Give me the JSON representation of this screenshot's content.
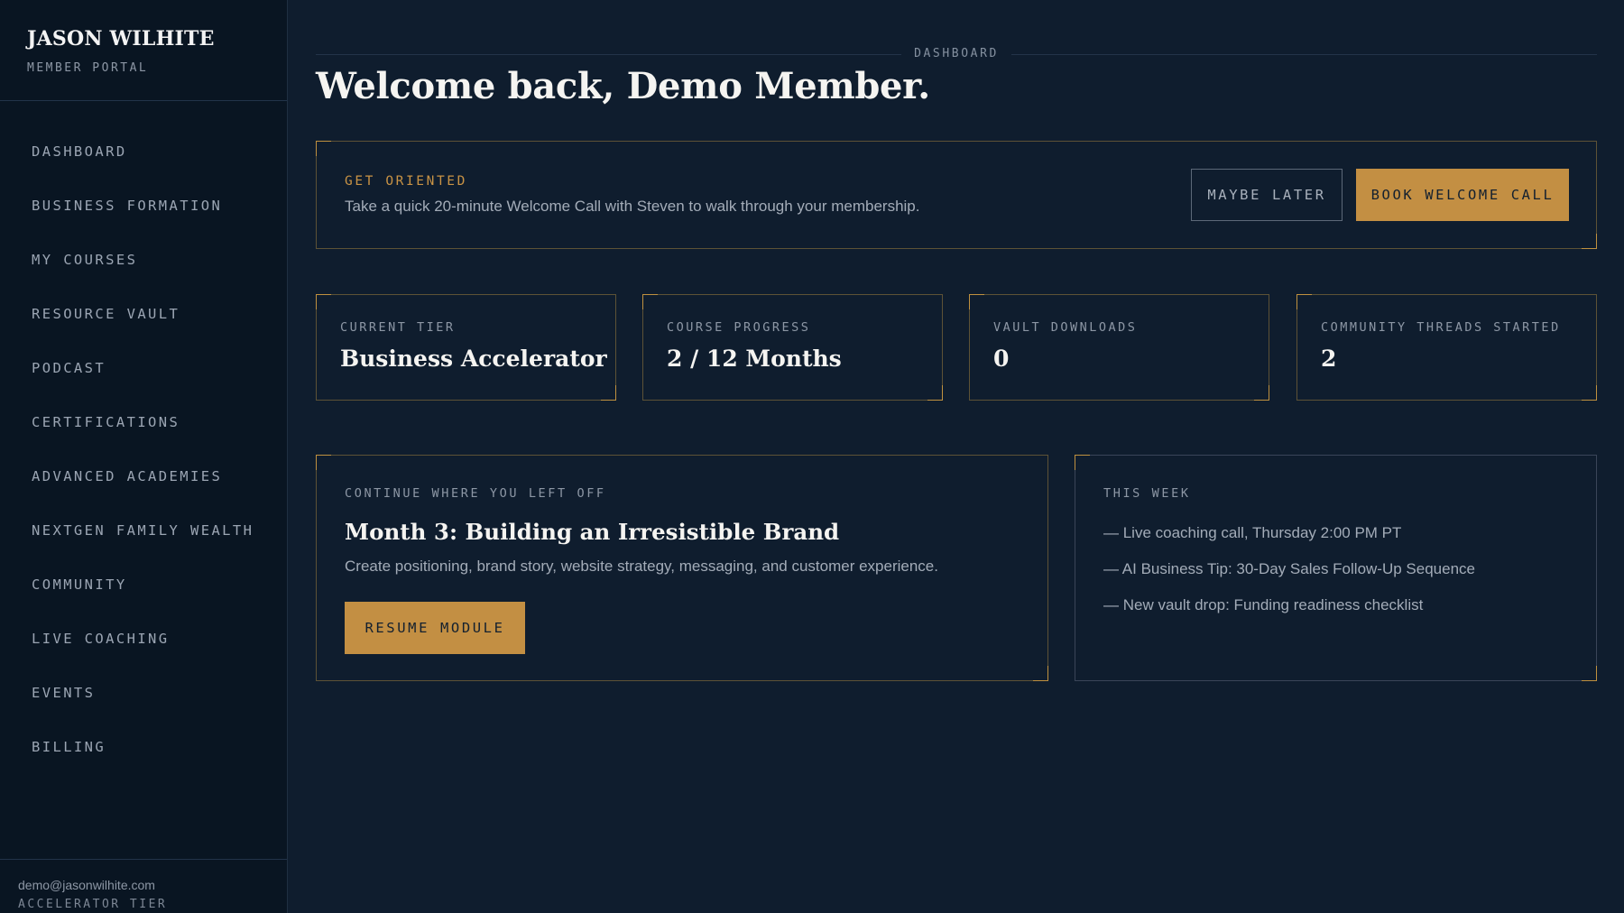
{
  "brand": {
    "name": "JASON WILHITE",
    "subtitle": "MEMBER PORTAL"
  },
  "nav": [
    "DASHBOARD",
    "BUSINESS FORMATION",
    "MY COURSES",
    "RESOURCE VAULT",
    "PODCAST",
    "CERTIFICATIONS",
    "ADVANCED ACADEMIES",
    "NEXTGEN FAMILY WEALTH",
    "COMMUNITY",
    "LIVE COACHING",
    "EVENTS",
    "BILLING"
  ],
  "account": {
    "email": "demo@jasonwilhite.com",
    "tier": "ACCELERATOR TIER"
  },
  "header": {
    "section": "DASHBOARD",
    "title": "Welcome back, Demo Member."
  },
  "orientation": {
    "label": "GET ORIENTED",
    "text": "Take a quick 20-minute Welcome Call with Steven to walk through your membership.",
    "dismiss_label": "MAYBE LATER",
    "book_label": "BOOK WELCOME CALL"
  },
  "stats": [
    {
      "label": "CURRENT TIER",
      "value": "Business Accelerator"
    },
    {
      "label": "COURSE PROGRESS",
      "value": "2 / 12 Months"
    },
    {
      "label": "VAULT DOWNLOADS",
      "value": "0"
    },
    {
      "label": "COMMUNITY THREADS STARTED",
      "value": "2"
    }
  ],
  "continue": {
    "label": "CONTINUE WHERE YOU LEFT OFF",
    "title": "Month 3: Building an Irresistible Brand",
    "description": "Create positioning, brand story, website strategy, messaging, and customer experience.",
    "button_label": "RESUME MODULE"
  },
  "this_week": {
    "label": "THIS WEEK",
    "items": [
      "— Live coaching call, Thursday 2:00 PM PT",
      "— AI Business Tip: 30-Day Sales Follow-Up Sequence",
      "— New vault drop: Funding readiness checklist"
    ]
  },
  "colors": {
    "background": "#0f1d2e",
    "sidebar": "#091522",
    "accent": "#c38f43"
  }
}
